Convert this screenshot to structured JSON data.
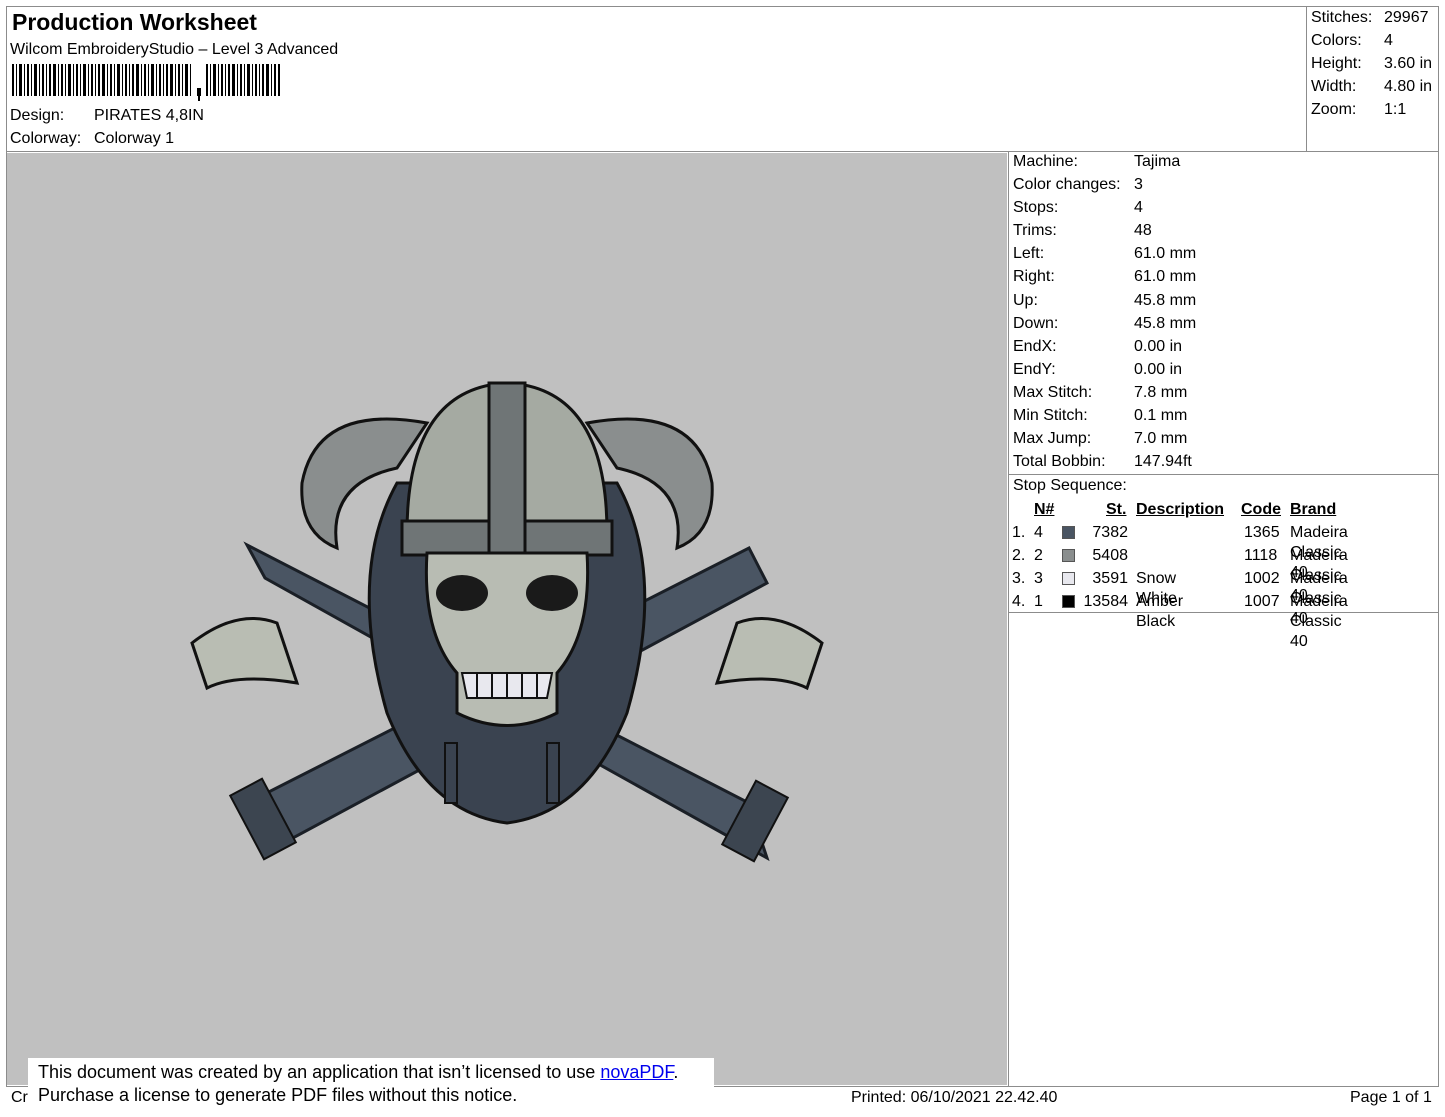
{
  "header": {
    "title": "Production Worksheet",
    "subtitle": "Wilcom EmbroideryStudio – Level 3 Advanced",
    "design_label": "Design:",
    "design_value": "PIRATES 4,8IN",
    "colorway_label": "Colorway:",
    "colorway_value": "Colorway 1"
  },
  "stats": [
    {
      "label": "Stitches:",
      "value": "29967"
    },
    {
      "label": "Colors:",
      "value": "4"
    },
    {
      "label": "Height:",
      "value": "3.60 in"
    },
    {
      "label": "Width:",
      "value": "4.80 in"
    },
    {
      "label": "Zoom:",
      "value": "1:1"
    }
  ],
  "machine_info": [
    {
      "label": "Machine:",
      "value": "Tajima"
    },
    {
      "label": "Color changes:",
      "value": "3"
    },
    {
      "label": "Stops:",
      "value": "4"
    },
    {
      "label": "Trims:",
      "value": "48"
    },
    {
      "label": "Left:",
      "value": "61.0 mm"
    },
    {
      "label": "Right:",
      "value": "61.0 mm"
    },
    {
      "label": "Up:",
      "value": "45.8 mm"
    },
    {
      "label": "Down:",
      "value": "45.8 mm"
    },
    {
      "label": "EndX:",
      "value": "0.00 in"
    },
    {
      "label": "EndY:",
      "value": "0.00 in"
    },
    {
      "label": "Max Stitch:",
      "value": "7.8 mm"
    },
    {
      "label": "Min Stitch:",
      "value": "0.1 mm"
    },
    {
      "label": "Max Jump:",
      "value": "7.0 mm"
    },
    {
      "label": "Total Bobbin:",
      "value": "147.94ft"
    }
  ],
  "stop_sequence": {
    "title": "Stop Sequence:",
    "headers": {
      "n": "N#",
      "st": "St.",
      "description": "Description",
      "code": "Code",
      "brand": "Brand"
    },
    "rows": [
      {
        "index": "1.",
        "n": "4",
        "color": "#4a5563",
        "st": "7382",
        "description": "",
        "code": "1365",
        "brand": "Madeira Classic 40"
      },
      {
        "index": "2.",
        "n": "2",
        "color": "#8a8e8e",
        "st": "5408",
        "description": "",
        "code": "1118",
        "brand": "Madeira Classic 40"
      },
      {
        "index": "3.",
        "n": "3",
        "color": "#e8e8ee",
        "st": "3591",
        "description": "Snow White",
        "code": "1002",
        "brand": "Madeira Classic 40"
      },
      {
        "index": "4.",
        "n": "1",
        "color": "#000000",
        "st": "13584",
        "description": "Amber Black",
        "code": "1007",
        "brand": "Madeira Classic 40"
      }
    ]
  },
  "notice": {
    "line1_before": "This document was created by an application that isn’t licensed to use ",
    "link": "novaPDF",
    "line1_after": ".",
    "line2": "Purchase a license to generate PDF files without this notice."
  },
  "footer": {
    "left": "Cr",
    "printed": "Printed: 06/10/2021 22.42.40",
    "page": "Page 1 of 1"
  },
  "colors": {
    "preview_bg": "#c0c0c0",
    "frame": "#8c8c8c"
  }
}
